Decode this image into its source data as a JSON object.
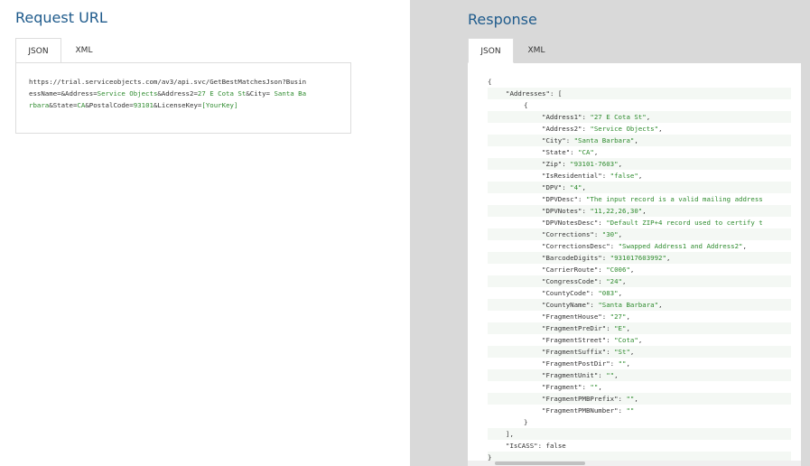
{
  "request": {
    "title": "Request URL",
    "tabs": [
      "JSON",
      "XML"
    ],
    "url": {
      "line1": "https://trial.serviceobjects.com/av3/api.svc/GetBestMatchesJson?Busin",
      "line2_a": "essName=&Address=",
      "line2_b": "Service Objects",
      "line2_c": "&Address2=",
      "line2_d": "27 E Cota St",
      "line2_e": "&City= ",
      "line2_f": "Santa Ba",
      "line3_a": "rbara",
      "line3_b": "&State=",
      "line3_c": "CA",
      "line3_d": "&PostalCode=",
      "line3_e": "93101",
      "line3_f": "&LicenseKey=",
      "line3_g": "[YourKey]"
    }
  },
  "response": {
    "title": "Response",
    "tabs": [
      "JSON",
      "XML"
    ],
    "open_brace": "{",
    "addresses_key": "\"Addresses\"",
    "addresses_open": ": [",
    "item_open": "{",
    "fields": [
      {
        "k": "\"Address1\"",
        "v": "\"27 E Cota St\"",
        "t": ","
      },
      {
        "k": "\"Address2\"",
        "v": "\"Service Objects\"",
        "t": ","
      },
      {
        "k": "\"City\"",
        "v": "\"Santa Barbara\"",
        "t": ","
      },
      {
        "k": "\"State\"",
        "v": "\"CA\"",
        "t": ","
      },
      {
        "k": "\"Zip\"",
        "v": "\"93101-7603\"",
        "t": ","
      },
      {
        "k": "\"IsResidential\"",
        "v": "\"false\"",
        "t": ","
      },
      {
        "k": "\"DPV\"",
        "v": "\"4\"",
        "t": ","
      },
      {
        "k": "\"DPVDesc\"",
        "v": "\"The input record is a valid mailing address",
        "t": ""
      },
      {
        "k": "\"DPVNotes\"",
        "v": "\"11,22,26,30\"",
        "t": ","
      },
      {
        "k": "\"DPVNotesDesc\"",
        "v": "\"Default ZIP+4 record used to certify t",
        "t": ""
      },
      {
        "k": "\"Corrections\"",
        "v": "\"30\"",
        "t": ","
      },
      {
        "k": "\"CorrectionsDesc\"",
        "v": "\"Swapped Address1 and Address2\"",
        "t": ","
      },
      {
        "k": "\"BarcodeDigits\"",
        "v": "\"931017603992\"",
        "t": ","
      },
      {
        "k": "\"CarrierRoute\"",
        "v": "\"C006\"",
        "t": ","
      },
      {
        "k": "\"CongressCode\"",
        "v": "\"24\"",
        "t": ","
      },
      {
        "k": "\"CountyCode\"",
        "v": "\"083\"",
        "t": ","
      },
      {
        "k": "\"CountyName\"",
        "v": "\"Santa Barbara\"",
        "t": ","
      },
      {
        "k": "\"FragmentHouse\"",
        "v": "\"27\"",
        "t": ","
      },
      {
        "k": "\"FragmentPreDir\"",
        "v": "\"E\"",
        "t": ","
      },
      {
        "k": "\"FragmentStreet\"",
        "v": "\"Cota\"",
        "t": ","
      },
      {
        "k": "\"FragmentSuffix\"",
        "v": "\"St\"",
        "t": ","
      },
      {
        "k": "\"FragmentPostDir\"",
        "v": "\"\"",
        "t": ","
      },
      {
        "k": "\"FragmentUnit\"",
        "v": "\"\"",
        "t": ","
      },
      {
        "k": "\"Fragment\"",
        "v": "\"\"",
        "t": ","
      },
      {
        "k": "\"FragmentPMBPrefix\"",
        "v": "\"\"",
        "t": ","
      },
      {
        "k": "\"FragmentPMBNumber\"",
        "v": "\"\"",
        "t": ""
      }
    ],
    "item_close": "}",
    "addresses_close": "],",
    "iscass_key": "\"IsCASS\"",
    "iscass_val": ": false",
    "close_brace": "}"
  },
  "colors": {
    "title": "#1f5b8c",
    "json_value": "#2e8b2e",
    "response_bg": "#d9d9d9"
  }
}
